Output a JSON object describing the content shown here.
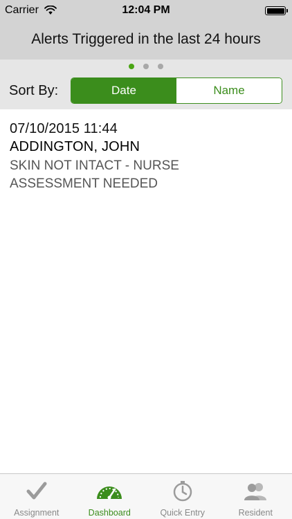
{
  "status_bar": {
    "carrier": "Carrier",
    "time": "12:04 PM"
  },
  "header": {
    "title": "Alerts Triggered in the last 24 hours"
  },
  "pager": {
    "count": 3,
    "active_index": 0
  },
  "sort": {
    "label": "Sort By:",
    "options": [
      "Date",
      "Name"
    ],
    "selected": "Date"
  },
  "alerts": [
    {
      "datetime": "07/10/2015 11:44",
      "resident": "ADDINGTON, JOHN",
      "description": "SKIN NOT INTACT - NURSE ASSESSMENT NEEDED"
    }
  ],
  "tab_bar": {
    "tabs": [
      {
        "label": "Assignment",
        "icon": "checkmark-icon"
      },
      {
        "label": "Dashboard",
        "icon": "dashboard-gauge-icon"
      },
      {
        "label": "Quick Entry",
        "icon": "stopwatch-icon"
      },
      {
        "label": "Resident",
        "icon": "people-icon"
      }
    ],
    "active": "Dashboard"
  },
  "colors": {
    "accent_green": "#3b8d1c",
    "dot_active": "#4aa514",
    "header_gray": "#d3d3d3",
    "inactive_icon": "#9b9b9b"
  }
}
